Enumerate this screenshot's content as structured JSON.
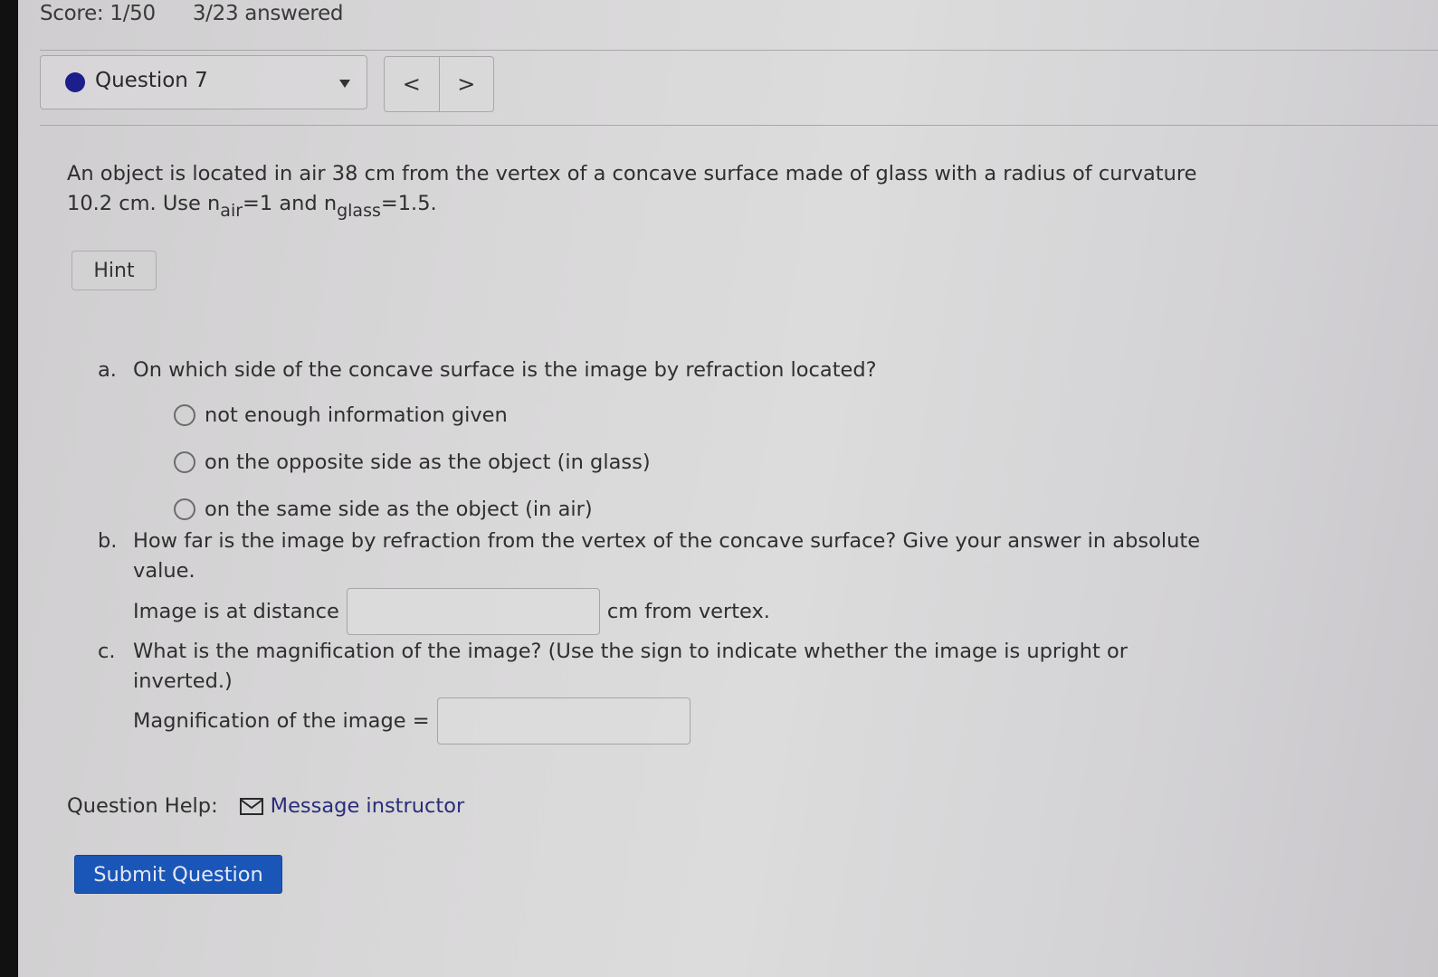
{
  "header": {
    "score": "Score: 1/50",
    "answered": "3/23 answered"
  },
  "question_nav": {
    "selected": "Question 7",
    "status_color": "#1c1e8c",
    "prev_label": "<",
    "next_label": ">"
  },
  "problem": {
    "line1": "An object is located in air 38 cm from the vertex of a concave surface made of glass with a radius of curvature",
    "line2_prefix": "10.2 cm. Use n",
    "sub_air": "air",
    "eq1": "=1 and n",
    "sub_glass": "glass",
    "eq2": "=1.5."
  },
  "hint_label": "Hint",
  "parts": {
    "a": {
      "letter": "a.",
      "question": "On which side of the concave surface is the image by refraction located?",
      "options": [
        "not enough information given",
        "on the opposite side as the object (in glass)",
        "on the same side as the object (in air)"
      ]
    },
    "b": {
      "letter": "b.",
      "question_line1": "How far is the image by refraction from the vertex of the concave surface? Give your answer in absolute",
      "question_line2": "value.",
      "prefix": "Image is at distance",
      "value": "",
      "suffix": "cm from vertex."
    },
    "c": {
      "letter": "c.",
      "question_line1": "What is the magnification of the image? (Use the sign to indicate whether the image is upright or",
      "question_line2": "inverted.)",
      "prefix": "Magnification of the image =",
      "value": ""
    }
  },
  "help": {
    "label": "Question Help:",
    "icon": "mail-icon",
    "link": "Message instructor"
  },
  "submit_label": "Submit Question",
  "colors": {
    "submit_bg": "#1a56b8",
    "link": "#2a2d7a"
  }
}
